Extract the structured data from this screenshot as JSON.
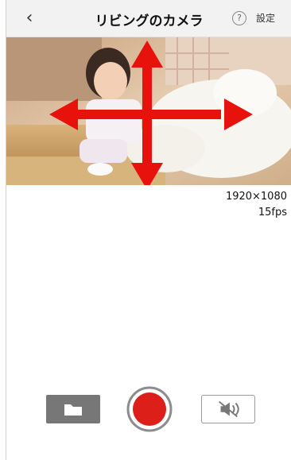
{
  "header": {
    "back_icon": "chevron-left-icon",
    "title": "リビングのカメラ",
    "help_icon": "question-circle-icon",
    "help_label": "?",
    "settings_label": "設定"
  },
  "video": {
    "overlay_icon": "move-arrows-icon",
    "overlay_color": "#e8120c"
  },
  "stream_info": {
    "resolution": "1920×1080",
    "framerate": "15fps"
  },
  "controls": {
    "folder_icon": "folder-icon",
    "record_icon": "record-icon",
    "record_color": "#dd1f1a",
    "mute_icon": "speaker-muted-icon"
  }
}
